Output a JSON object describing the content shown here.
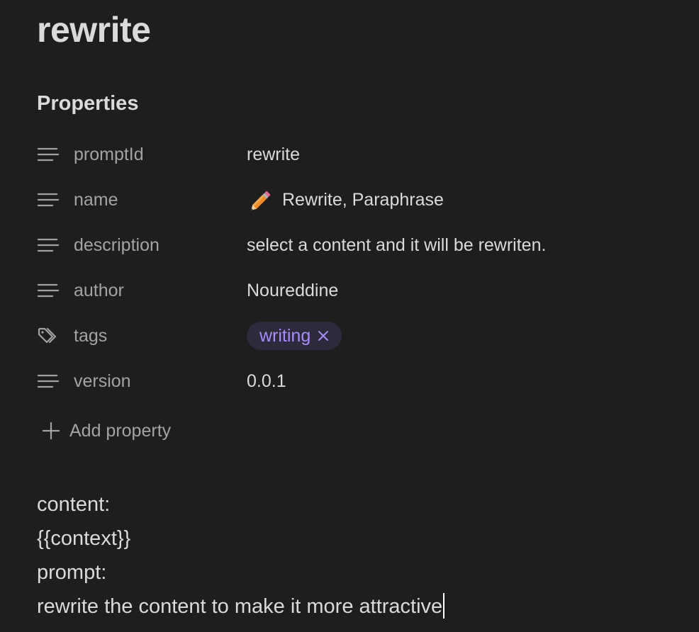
{
  "note": {
    "title": "rewrite"
  },
  "properties": {
    "heading": "Properties",
    "items": [
      {
        "key": "promptId",
        "icon": "text-lines-icon",
        "value": "rewrite"
      },
      {
        "key": "name",
        "icon": "text-lines-icon",
        "value_emoji": "pencil-emoji",
        "value": "Rewrite, Paraphrase"
      },
      {
        "key": "description",
        "icon": "text-lines-icon",
        "value": "select a content and it will be rewriten."
      },
      {
        "key": "author",
        "icon": "text-lines-icon",
        "value": "Noureddine"
      },
      {
        "key": "tags",
        "icon": "tags-icon",
        "tags": [
          "writing"
        ]
      },
      {
        "key": "version",
        "icon": "text-lines-icon",
        "value": "0.0.1"
      }
    ],
    "add_label": "Add property"
  },
  "body": {
    "lines": [
      "content:",
      "{{context}}",
      "prompt:",
      "rewrite the content to make it more attractive"
    ]
  },
  "colors": {
    "background": "#1e1e1e",
    "text": "#dadada",
    "muted": "#a3a3a3",
    "tag_text": "#a88bfa",
    "tag_bg": "#2d2b3b"
  }
}
